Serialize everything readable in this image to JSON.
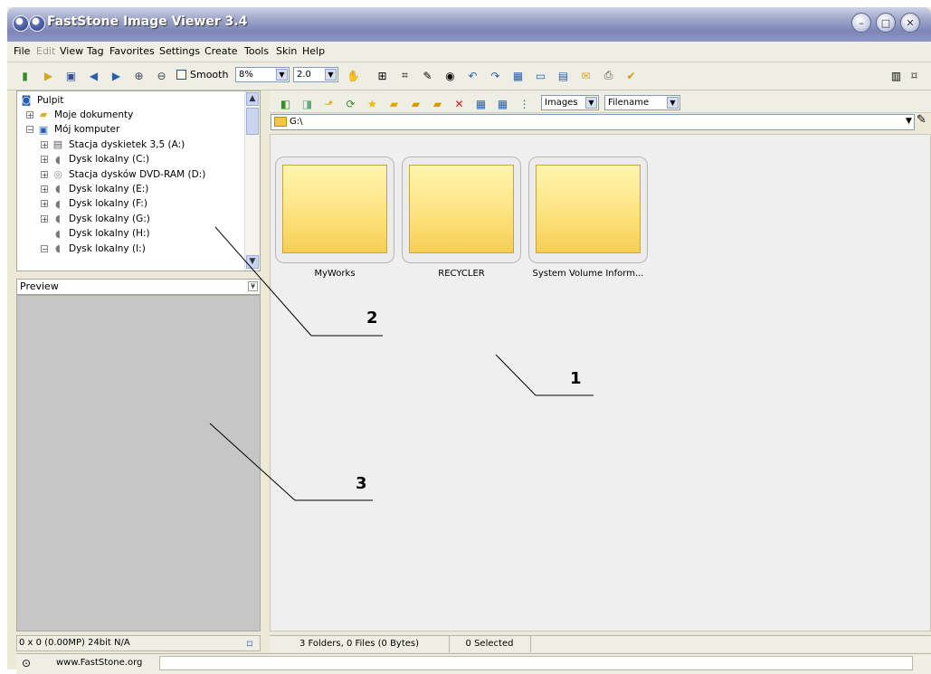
{
  "window": {
    "title": "FastStone Image Viewer 3.4"
  },
  "menu": [
    "File",
    "Edit",
    "View",
    "Tag",
    "Favorites",
    "Settings",
    "Create",
    "Tools",
    "Skin",
    "Help"
  ],
  "menu_disabled": [
    "Edit"
  ],
  "toolbar": {
    "smooth_label": "Smooth",
    "zoom_value": "8%",
    "gamma_value": "2.0"
  },
  "tree": {
    "items": [
      {
        "label": "Pulpit",
        "icon": "desktop-icon"
      },
      {
        "label": "Moje dokumenty",
        "icon": "folder-icon"
      },
      {
        "label": "Mój komputer",
        "icon": "computer-icon"
      },
      {
        "label": "Stacja dyskietek 3,5 (A:)",
        "icon": "floppy-icon"
      },
      {
        "label": "Dysk lokalny (C:)",
        "icon": "drive-icon"
      },
      {
        "label": "Stacja dysków DVD-RAM (D:)",
        "icon": "dvd-icon"
      },
      {
        "label": "Dysk lokalny (E:)",
        "icon": "drive-icon"
      },
      {
        "label": "Dysk lokalny (F:)",
        "icon": "drive-icon"
      },
      {
        "label": "Dysk lokalny (G:)",
        "icon": "drive-icon"
      },
      {
        "label": "Dysk lokalny (H:)",
        "icon": "drive-icon"
      },
      {
        "label": "Dysk lokalny (I:)",
        "icon": "drive-icon"
      }
    ]
  },
  "preview": {
    "header": "Preview",
    "status": "0 x 0 (0.00MP)  24bit N/A"
  },
  "browser": {
    "filter_value": "Images",
    "sort_value": "Filename",
    "path": "G:\\",
    "folders": [
      "MyWorks",
      "RECYCLER",
      "System Volume Inform..."
    ]
  },
  "status": {
    "summary": "3 Folders, 0 Files (0 Bytes)",
    "selected": "0 Selected"
  },
  "bottom": {
    "website": "www.FastStone.org"
  },
  "annotations": [
    "1",
    "2",
    "3"
  ],
  "colors": {
    "accent": "#7c86b8",
    "folder": "#fde585",
    "preview_bg": "#c6c6c6"
  }
}
